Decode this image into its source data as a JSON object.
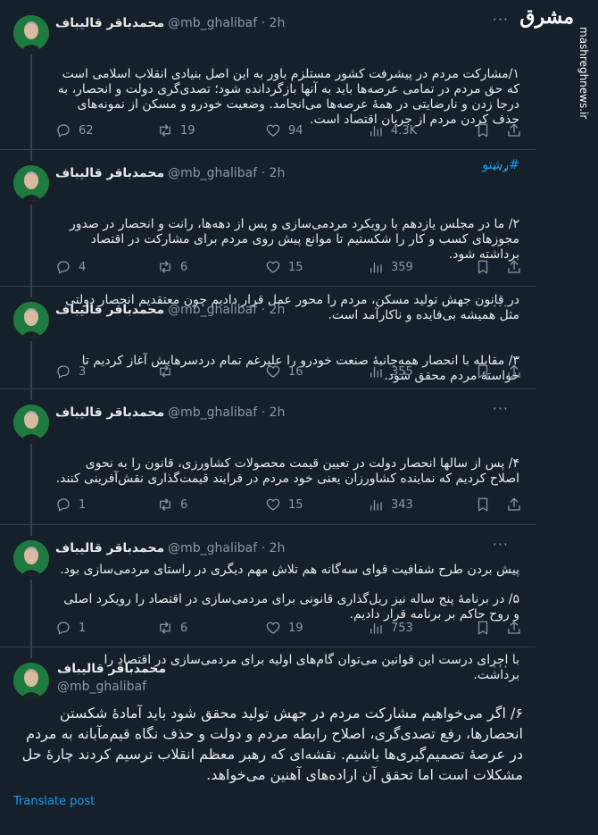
{
  "author": {
    "name": "محمدباقر قالیباف",
    "handle": "@mb_ghalibaf",
    "time": "2h"
  },
  "tweets": [
    {
      "paragraphs": [
        "۱/مشارکت مردم در پیشرفت کشور مستلزم باور به این اصل بنیادی انقلاب اسلامی است که حق مردم در تمامی عرصه‌ها باید به آنها بازگردانده شود؛ تصدی‌گری دولت و انحصار، به درجا زدن و نارضایتی در همهٔ عرصه‌ها می‌انجامد. وضعیت خودرو و مسکن از نمونه‌های حذف کردن مردم از جریان اقتصاد است."
      ],
      "hashtag": "#رشتو",
      "stats": {
        "replies": "62",
        "retweets": "19",
        "likes": "94",
        "views": "4.3K"
      }
    },
    {
      "paragraphs": [
        "۲/ ما در مجلس یازدهم با رویکرد مردمی‌سازی و پس از دهه‌ها، رانت و انحصار در صدور مجوزهای کسب و کار را شکستیم تا موانع پیش روی مردم برای مشارکت در اقتصاد برداشته شود.",
        "در قانون جهش تولید مسکن، مردم را محور عمل قرار دادیم چون معتقدیم انحصار دولتی مثل همیشه بی‌فایده و ناکارآمد است."
      ],
      "stats": {
        "replies": "4",
        "retweets": "6",
        "likes": "15",
        "views": "359"
      }
    },
    {
      "paragraphs": [
        "۳/ مقابله با انحصار همه‌جانبهٔ صنعت خودرو را علیرغم تمام دردسرهایش آغاز کردیم تا خواستهٔ مردم محقق شود."
      ],
      "stats": {
        "replies": "3",
        "retweets": "",
        "likes": "16",
        "views": "355"
      }
    },
    {
      "paragraphs": [
        "۴/ پس از سالها انحصار دولت در تعیین قیمت محصولات کشاورزی، قانون را به نحوی اصلاح کردیم که نماینده کشاورزان یعنی خود مردم در فرایند قیمت‌گذاری نقش‌آفرینی کنند.",
        "",
        "پیش بردن طرح شفافیت قوای سه‌گانه هم تلاش مهم دیگری در راستای مردمی‌سازی بود."
      ],
      "stats": {
        "replies": "1",
        "retweets": "6",
        "likes": "15",
        "views": "343"
      }
    },
    {
      "paragraphs": [
        "۵/ در برنامهٔ پنج ساله نیز ریل‌گذاری قانونی برای مردمی‌سازی در اقتصاد را رویکرد اصلی و روح حاکم بر برنامه قرار دادیم.",
        "با اجرای درست این قوانین می‌توان گام‌های اولیه برای مردمی‌سازی در اقتصاد را برداشت."
      ],
      "stats": {
        "replies": "1",
        "retweets": "6",
        "likes": "19",
        "views": "753"
      }
    }
  ],
  "main_tweet": {
    "text": "۶/ اگر می‌خواهیم مشارکت مردم در جهش تولید محقق شود باید آمادهٔ شکستن انحصارها، رفع تصدی‌گری، اصلاح رابطه مردم و دولت و حذف نگاه قیم‌مآبانه به مردم در عرصهٔ تصمیم‌گیری‌ها باشیم. نقشه‌ای که رهبر معظم انقلاب ترسیم کردند چارهٔ حل مشکلات است اما تحقق آن اراده‌های آهنین می‌خواهد.",
    "translate_label": "Translate post"
  },
  "watermark": {
    "logo": "مشرق",
    "url": "mashreghnews.ir"
  },
  "icons": [
    "reply-icon",
    "retweet-icon",
    "like-icon",
    "views-icon",
    "bookmark-icon",
    "share-icon",
    "more-icon"
  ]
}
